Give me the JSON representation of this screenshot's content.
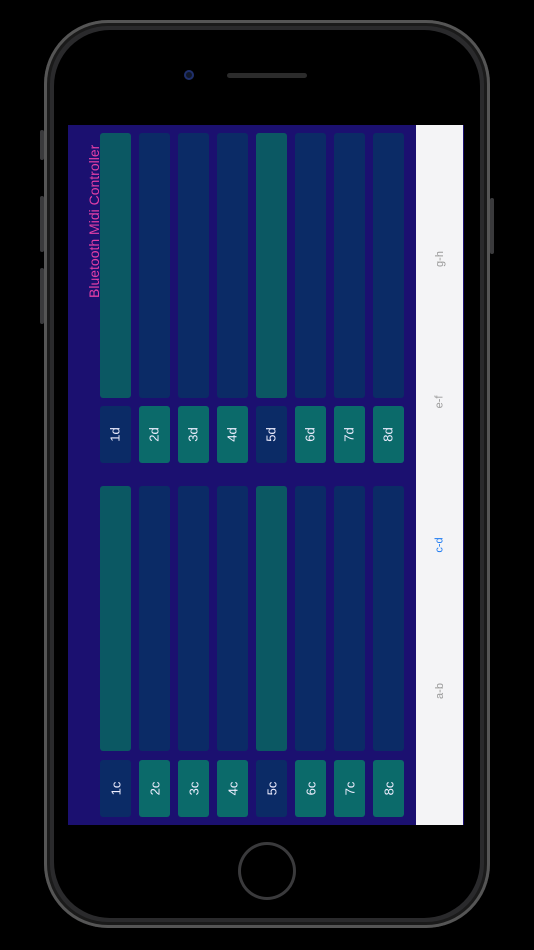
{
  "app": {
    "title": "Bluetooth Midi Controller"
  },
  "colors": {
    "background": "#1b1070",
    "title": "#e33fa7",
    "fader_dark": "#0b2b66",
    "fader_teal": "#0b5863",
    "button_teal": "#0b6a6a",
    "tab_active": "#1e7bf2"
  },
  "bank_top": {
    "buttons": [
      {
        "label": "1d",
        "style": "dark"
      },
      {
        "label": "2d",
        "style": "teal"
      },
      {
        "label": "3d",
        "style": "teal"
      },
      {
        "label": "4d",
        "style": "teal"
      },
      {
        "label": "5d",
        "style": "dark"
      },
      {
        "label": "6d",
        "style": "teal"
      },
      {
        "label": "7d",
        "style": "teal"
      },
      {
        "label": "8d",
        "style": "teal"
      }
    ]
  },
  "bank_bottom": {
    "buttons": [
      {
        "label": "1c",
        "style": "dark"
      },
      {
        "label": "2c",
        "style": "teal"
      },
      {
        "label": "3c",
        "style": "teal"
      },
      {
        "label": "4c",
        "style": "teal"
      },
      {
        "label": "5c",
        "style": "dark"
      },
      {
        "label": "6c",
        "style": "teal"
      },
      {
        "label": "7c",
        "style": "teal"
      },
      {
        "label": "8c",
        "style": "teal"
      }
    ]
  },
  "tabs": [
    {
      "label": "g-h",
      "active": false
    },
    {
      "label": "e-f",
      "active": false
    },
    {
      "label": "c-d",
      "active": true
    },
    {
      "label": "a-b",
      "active": false
    }
  ]
}
